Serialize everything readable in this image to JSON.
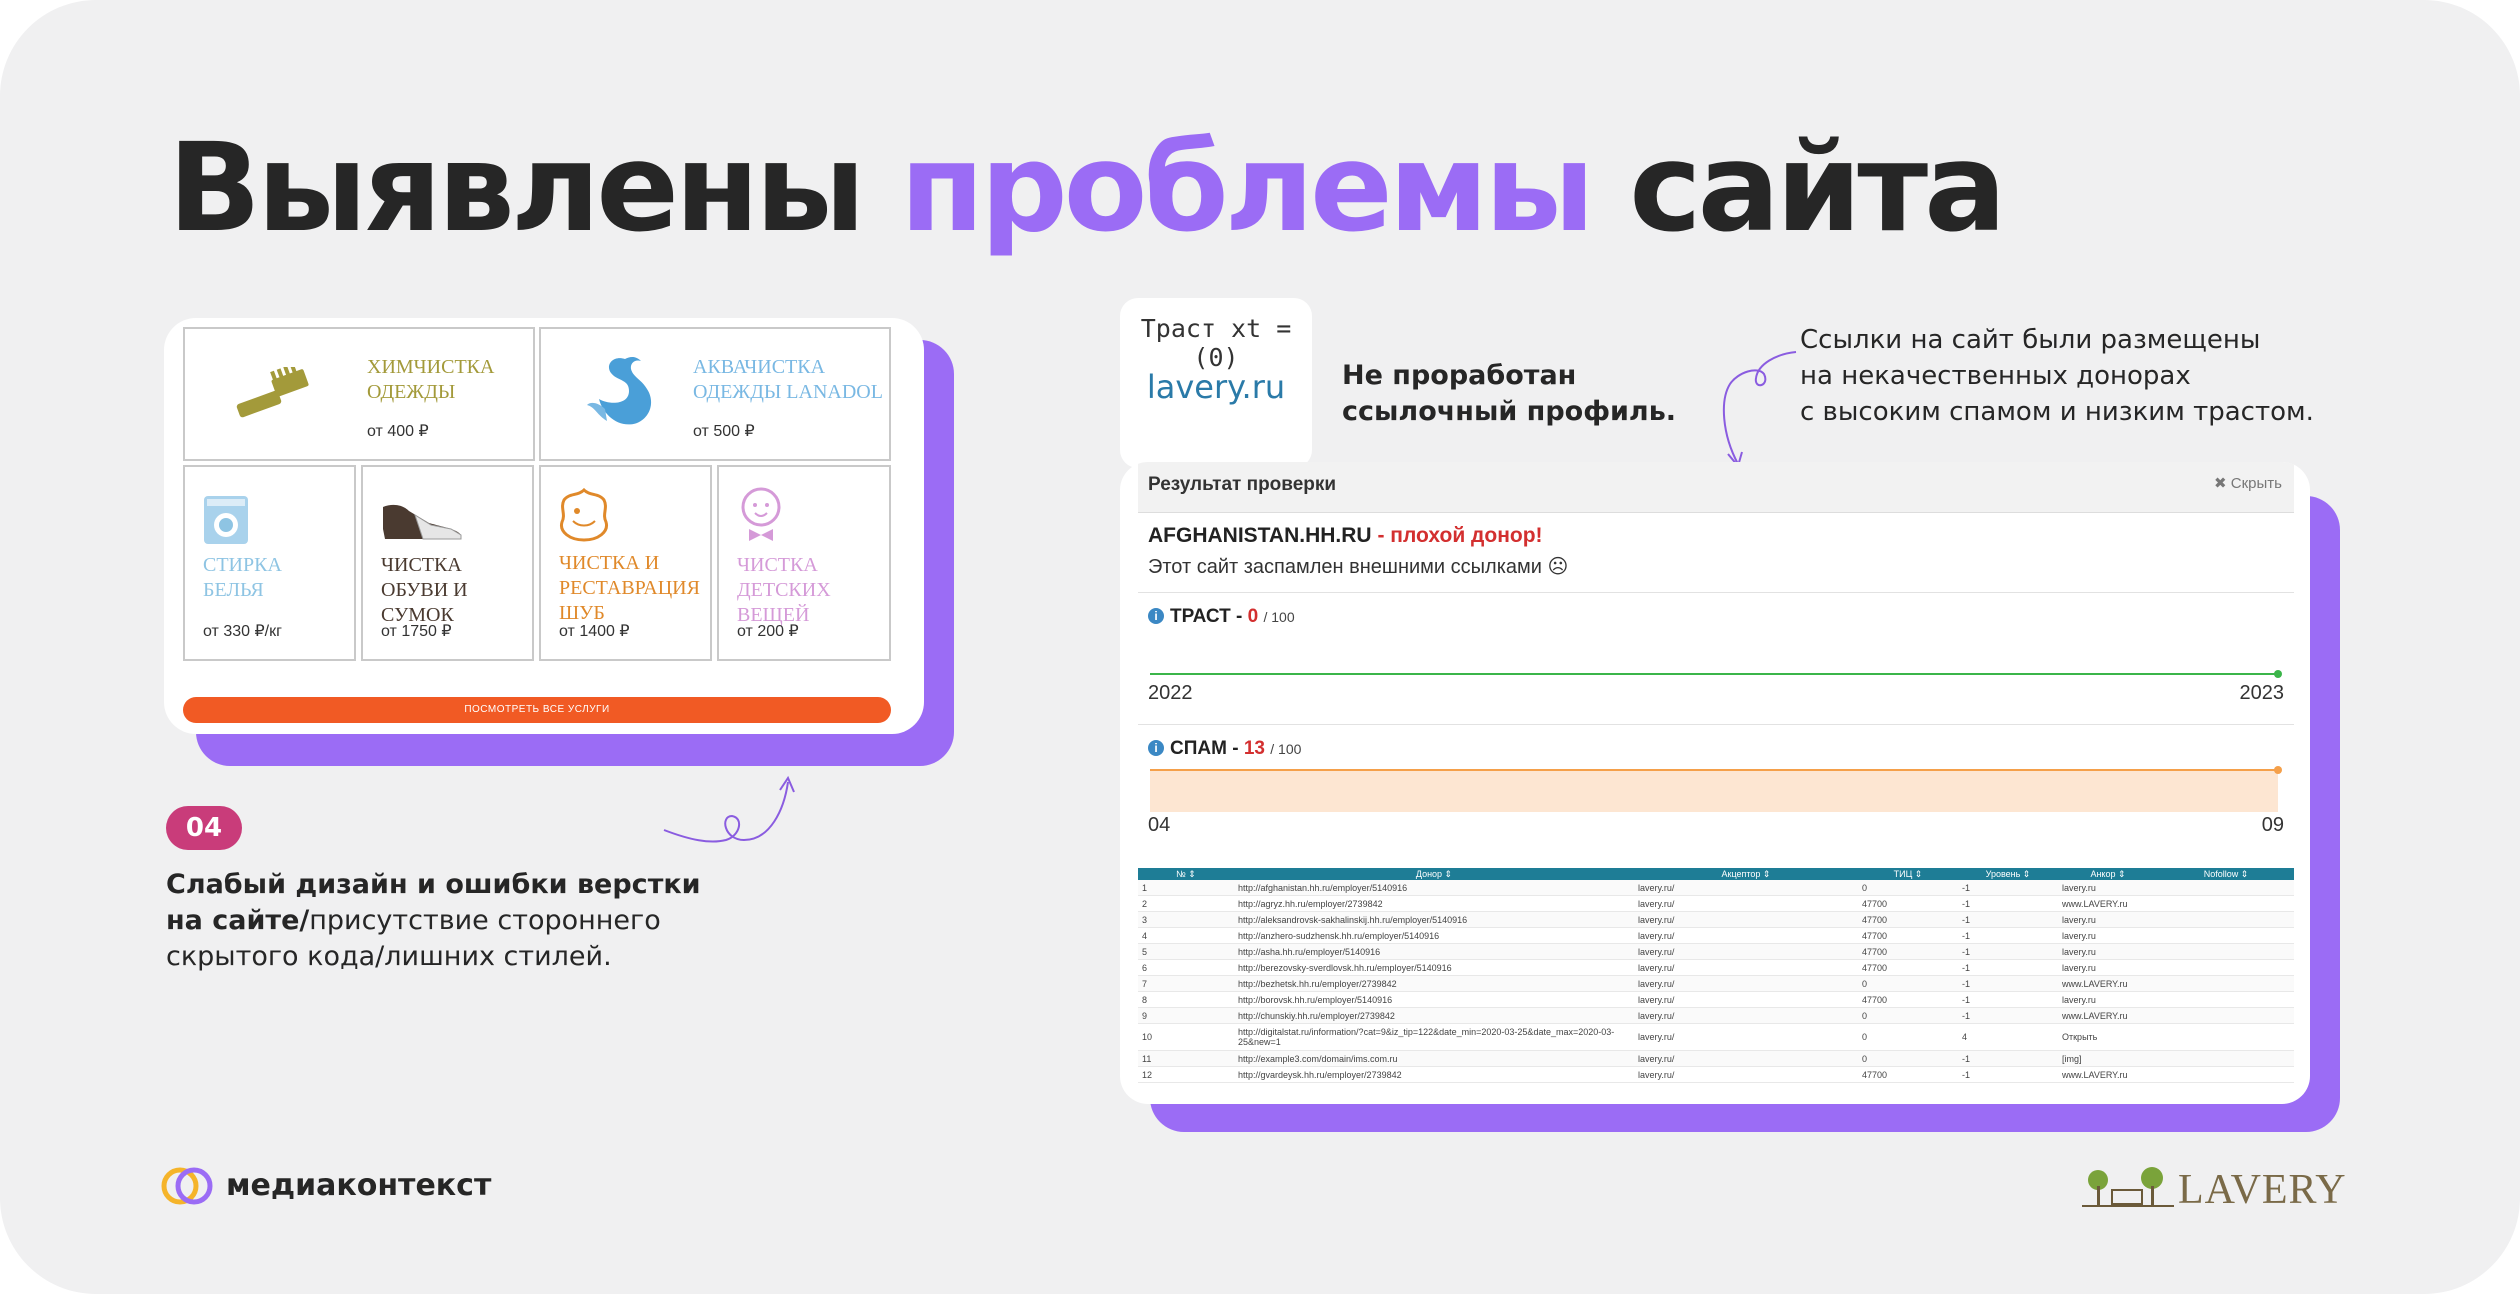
{
  "title": {
    "part1": "Выявлены ",
    "accent": "проблемы",
    "part2": " сайта"
  },
  "services": {
    "tiles": [
      {
        "name": "ХИМЧИСТКА\nОДЕЖДЫ",
        "price": "от 400 ₽",
        "color": "#a39a3a",
        "icon": "brush-icon"
      },
      {
        "name": "АКВАЧИСТКА\nОДЕЖДЫ Lanadol",
        "price": "от 500 ₽",
        "color": "#79b8e3",
        "icon": "swan-icon"
      },
      {
        "name": "СТИРКА\nБЕЛЬЯ",
        "price": "от 330 ₽/кг",
        "color": "#8ec4e3",
        "icon": "washing-machine-icon"
      },
      {
        "name": "ЧИСТКА\nОБУВИ и СУМОК",
        "price": "от 1750 ₽",
        "color": "#4a3a30",
        "icon": "shoe-icon"
      },
      {
        "name": "ЧИСТКА И\nРЕСТАВРАЦИЯ\nШУБ",
        "price": "от 1400 ₽",
        "color": "#e0892a",
        "icon": "fur-icon"
      },
      {
        "name": "ЧИСТКА\nДЕТСКИХ ВЕЩЕЙ",
        "price": "от 200 ₽",
        "color": "#d59ad8",
        "icon": "baby-icon"
      }
    ],
    "button": "ПОСМОТРЕТЬ ВСЕ УСЛУГИ"
  },
  "issue": {
    "number": "04",
    "bold": "Слабый дизайн и ошибки верстки на сайте/",
    "text": "присутствие стороннего скрытого кода/лишних стилей."
  },
  "trust_box": {
    "label": "Траст xt = (0)",
    "site": "lavery.ru"
  },
  "mid_note": "Не проработан\nссылочный профиль.",
  "right_note": "Ссылки на сайт были размещены\nна некачественных донорах\nс высоким спамом и низким трастом.",
  "check": {
    "title": "Результат проверки",
    "hide": "✖ Скрыть",
    "donor": "AFGHANISTAN.HH.RU",
    "dash": " - ",
    "verdict": "плохой донор!",
    "spam_text": "Этот сайт заспамлен внешними ссылками ☹",
    "trust": {
      "label": "ТРАСТ",
      "value": "0",
      "max": "/ 100",
      "x_start": "2022",
      "x_end": "2023",
      "color": "#3bb54a"
    },
    "spam": {
      "label": "СПАМ",
      "value": "13",
      "max": "/ 100",
      "x_start": "04",
      "x_end": "09",
      "color": "#f5a04a"
    }
  },
  "table": {
    "headers": [
      "№",
      "Донор",
      "Акцептор",
      "ТИЦ",
      "Уровень",
      "Анкор",
      "Nofollow"
    ],
    "rows": [
      [
        "1",
        "http://afghanistan.hh.ru/employer/5140916",
        "lavery.ru/",
        "0",
        "-1",
        "lavery.ru",
        ""
      ],
      [
        "2",
        "http://agryz.hh.ru/employer/2739842",
        "lavery.ru/",
        "47700",
        "-1",
        "www.LAVERY.ru",
        ""
      ],
      [
        "3",
        "http://aleksandrovsk-sakhalinskij.hh.ru/employer/5140916",
        "lavery.ru/",
        "47700",
        "-1",
        "lavery.ru",
        ""
      ],
      [
        "4",
        "http://anzhero-sudzhensk.hh.ru/employer/5140916",
        "lavery.ru/",
        "47700",
        "-1",
        "lavery.ru",
        ""
      ],
      [
        "5",
        "http://asha.hh.ru/employer/5140916",
        "lavery.ru/",
        "47700",
        "-1",
        "lavery.ru",
        ""
      ],
      [
        "6",
        "http://berezovsky-sverdlovsk.hh.ru/employer/5140916",
        "lavery.ru/",
        "47700",
        "-1",
        "lavery.ru",
        ""
      ],
      [
        "7",
        "http://bezhetsk.hh.ru/employer/2739842",
        "lavery.ru/",
        "0",
        "-1",
        "www.LAVERY.ru",
        ""
      ],
      [
        "8",
        "http://borovsk.hh.ru/employer/5140916",
        "lavery.ru/",
        "47700",
        "-1",
        "lavery.ru",
        ""
      ],
      [
        "9",
        "http://chunskiy.hh.ru/employer/2739842",
        "lavery.ru/",
        "0",
        "-1",
        "www.LAVERY.ru",
        ""
      ],
      [
        "10",
        "http://digitalstat.ru/information/?cat=9&iz_tip=122&date_min=2020-03-25&date_max=2020-03-25&new=1",
        "lavery.ru/",
        "0",
        "4",
        "Открыть",
        ""
      ],
      [
        "11",
        "http://example3.com/domain/ims.com.ru",
        "lavery.ru/",
        "0",
        "-1",
        "[img]",
        ""
      ],
      [
        "12",
        "http://gvardeysk.hh.ru/employer/2739842",
        "lavery.ru/",
        "47700",
        "-1",
        "www.LAVERY.ru",
        ""
      ]
    ]
  },
  "brand": {
    "agency": "медиаконтекст",
    "client": "LAVERY"
  },
  "colors": {
    "accent": "#9b6cf5",
    "badge": "#c93c7a",
    "button": "#f15a24",
    "table_header": "#1e7d96"
  }
}
